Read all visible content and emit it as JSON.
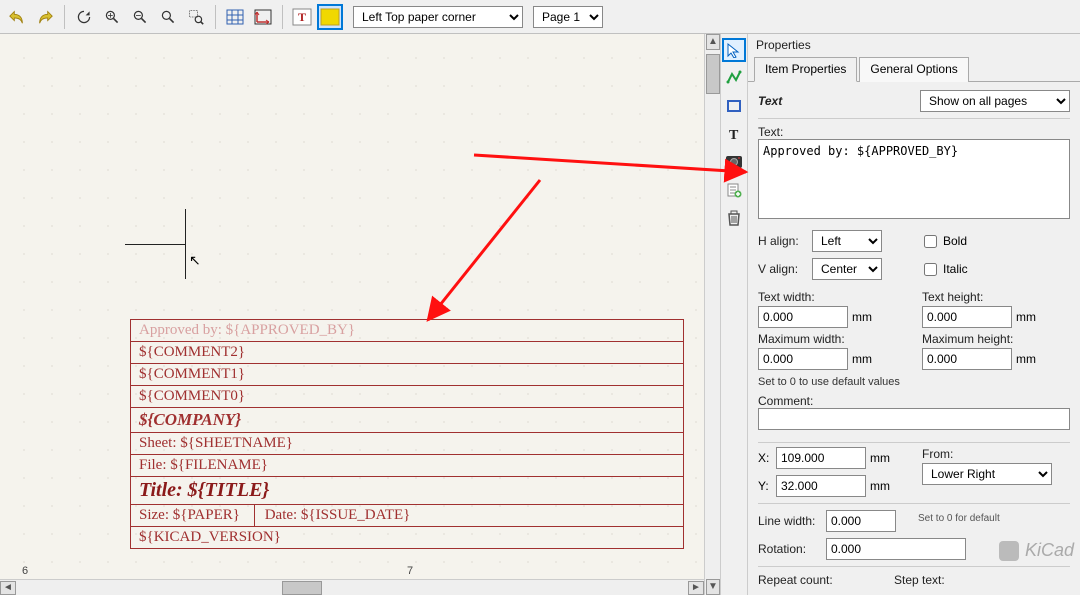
{
  "toolbar": {
    "origin_dropdown": "Left Top paper corner",
    "page_dropdown": "Page 1"
  },
  "canvas": {
    "title_block": {
      "approved_by": "Approved by: ${APPROVED_BY}",
      "comment2": "${COMMENT2}",
      "comment1": "${COMMENT1}",
      "comment0": "${COMMENT0}",
      "company": "${COMPANY}",
      "sheet": "Sheet: ${SHEETNAME}",
      "file": "File: ${FILENAME}",
      "title": "Title: ${TITLE}",
      "size": "Size: ${PAPER}",
      "date": "Date: ${ISSUE_DATE}",
      "kicad_version": "${KICAD_VERSION}"
    },
    "ruler": {
      "tick_6": "6",
      "tick_7": "7"
    }
  },
  "properties": {
    "panel_title": "Properties",
    "tabs": {
      "item": "Item Properties",
      "general": "General Options"
    },
    "section_text": "Text",
    "show_mode": "Show on all pages",
    "label_text": "Text:",
    "text_value": "Approved by: ${APPROVED_BY}",
    "halign_label": "H align:",
    "halign_value": "Left",
    "valign_label": "V align:",
    "valign_value": "Center",
    "bold_label": "Bold",
    "italic_label": "Italic",
    "text_width_label": "Text width:",
    "text_width_value": "0.000",
    "text_height_label": "Text height:",
    "text_height_value": "0.000",
    "max_width_label": "Maximum width:",
    "max_width_value": "0.000",
    "max_height_label": "Maximum height:",
    "max_height_value": "0.000",
    "unit_mm": "mm",
    "default_hint": "Set to 0 to use default values",
    "comment_label": "Comment:",
    "comment_value": "",
    "x_label": "X:",
    "x_value": "109.000",
    "y_label": "Y:",
    "y_value": "32.000",
    "from_label": "From:",
    "from_value": "Lower Right",
    "line_width_label": "Line width:",
    "line_width_value": "0.000",
    "line_width_hint": "Set to 0 for default",
    "rotation_label": "Rotation:",
    "rotation_value": "0.000",
    "repeat_label": "Repeat count:",
    "step_label": "Step text:"
  },
  "watermark": "KiCad"
}
